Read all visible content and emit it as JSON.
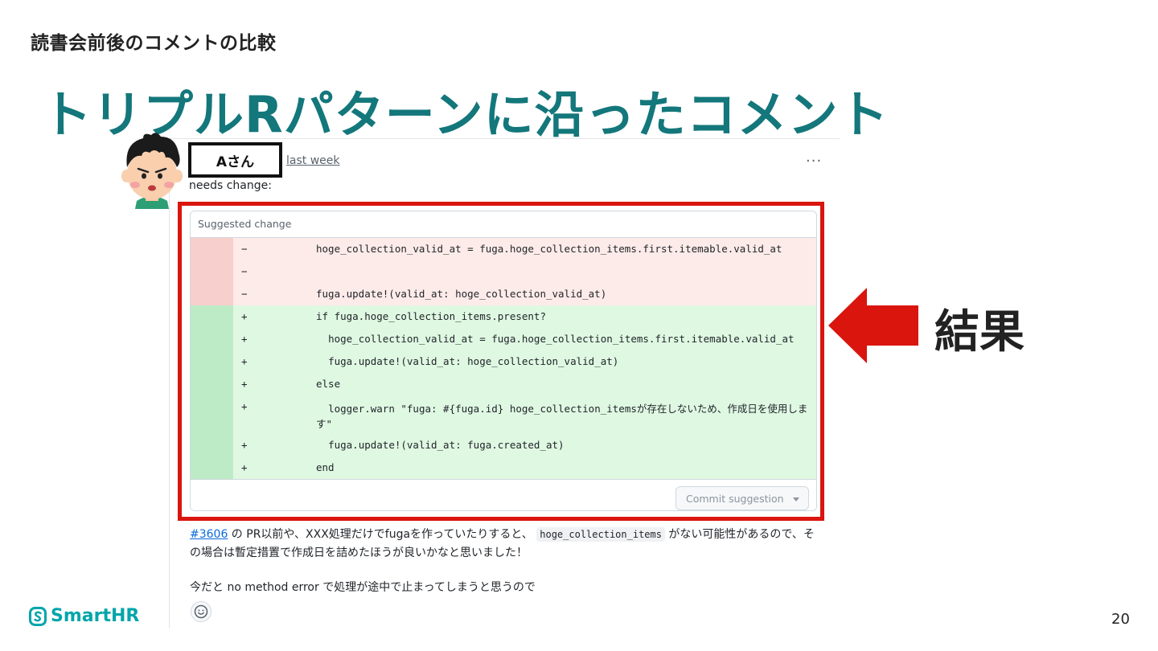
{
  "slide": {
    "section_title": "読書会前後のコメントの比較",
    "main_title": "トリプルRパターンに沿ったコメント",
    "result_label": "結果",
    "page_number": "20",
    "logo_text": "SmartHR",
    "colors": {
      "title": "#13777b",
      "accent_red": "#d9150e",
      "logo": "#00a5ab"
    }
  },
  "comment": {
    "author": "Aさん",
    "timestamp": "last week",
    "more_icon": "kebab-horizontal-icon",
    "header": "needs change:",
    "suggestion": {
      "label": "Suggested change",
      "lines": [
        {
          "type": "del",
          "sign": "−",
          "code": "hoge_collection_valid_at = fuga.hoge_collection_items.first.itemable.valid_at"
        },
        {
          "type": "del",
          "sign": "−",
          "code": ""
        },
        {
          "type": "del",
          "sign": "−",
          "code": "fuga.update!(valid_at: hoge_collection_valid_at)"
        },
        {
          "type": "add",
          "sign": "+",
          "code": "if fuga.hoge_collection_items.present?"
        },
        {
          "type": "add",
          "sign": "+",
          "code": "  hoge_collection_valid_at = fuga.hoge_collection_items.first.itemable.valid_at"
        },
        {
          "type": "add",
          "sign": "+",
          "code": "  fuga.update!(valid_at: hoge_collection_valid_at)"
        },
        {
          "type": "add",
          "sign": "+",
          "code": "else"
        },
        {
          "type": "add",
          "sign": "+",
          "code": "  logger.warn \"fuga: #{fuga.id} hoge_collection_itemsが存在しないため、作成日を使用します\""
        },
        {
          "type": "add",
          "sign": "+",
          "code": "  fuga.update!(valid_at: fuga.created_at)"
        },
        {
          "type": "add",
          "sign": "+",
          "code": "end"
        }
      ],
      "commit_button": "Commit suggestion"
    },
    "body": {
      "ref": "#3606",
      "p1_a": " の PR以前や、XXX処理だけでfugaを作っていたりすると、",
      "p1_code": "hoge_collection_items",
      "p1_b": " がない可能性があるので、その場合は暫定措置で作成日を詰めたほうが良いかなと思いました！",
      "p2": "今だと no method error で処理が途中で止まってしまうと思うので"
    },
    "reaction_icon": "smiley-icon"
  }
}
